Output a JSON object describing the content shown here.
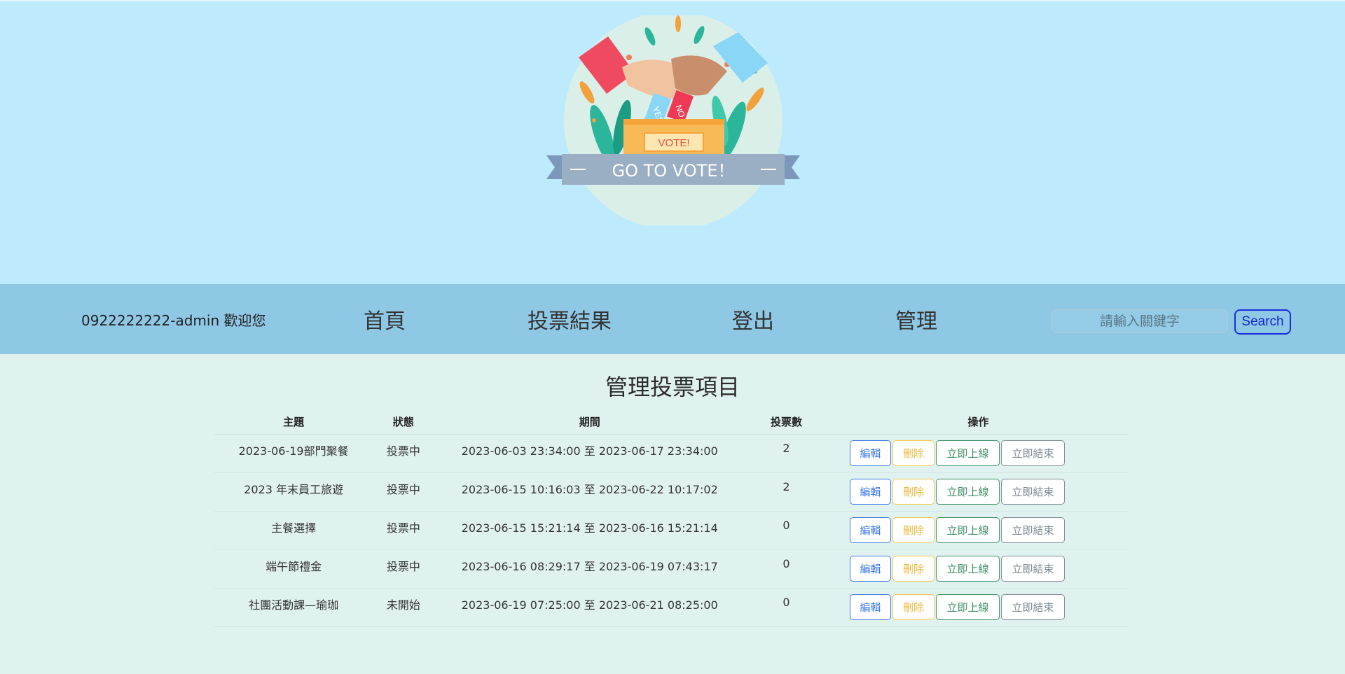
{
  "banner": {
    "box_label": "VOTE!",
    "ribbon_text": "GO TO VOTE！",
    "ballot_yes": "YES",
    "ballot_no": "NO"
  },
  "nav": {
    "welcome": "0922222222-admin 歡迎您",
    "home": "首頁",
    "results": "投票結果",
    "logout": "登出",
    "admin": "管理",
    "search_placeholder": "請輸入關鍵字",
    "search_button": "Search"
  },
  "main": {
    "title": "管理投票項目",
    "columns": {
      "topic": "主題",
      "status": "狀態",
      "period": "期間",
      "votes": "投票數",
      "ops": "操作"
    },
    "buttons": {
      "edit": "編輯",
      "delete": "刪除",
      "online": "立即上線",
      "end": "立即結束"
    },
    "rows": [
      {
        "topic": "2023-06-19部門聚餐",
        "status": "投票中",
        "period": "2023-06-03 23:34:00 至 2023-06-17 23:34:00",
        "votes": "2"
      },
      {
        "topic": "2023 年末員工旅遊",
        "status": "投票中",
        "period": "2023-06-15 10:16:03 至 2023-06-22 10:17:02",
        "votes": "2"
      },
      {
        "topic": "主餐選擇",
        "status": "投票中",
        "period": "2023-06-15 15:21:14 至 2023-06-16 15:21:14",
        "votes": "0"
      },
      {
        "topic": "端午節禮金",
        "status": "投票中",
        "period": "2023-06-16 08:29:17 至 2023-06-19 07:43:17",
        "votes": "0"
      },
      {
        "topic": "社團活動課—瑜珈",
        "status": "未開始",
        "period": "2023-06-19 07:25:00 至 2023-06-21 08:25:00",
        "votes": "0"
      }
    ]
  }
}
